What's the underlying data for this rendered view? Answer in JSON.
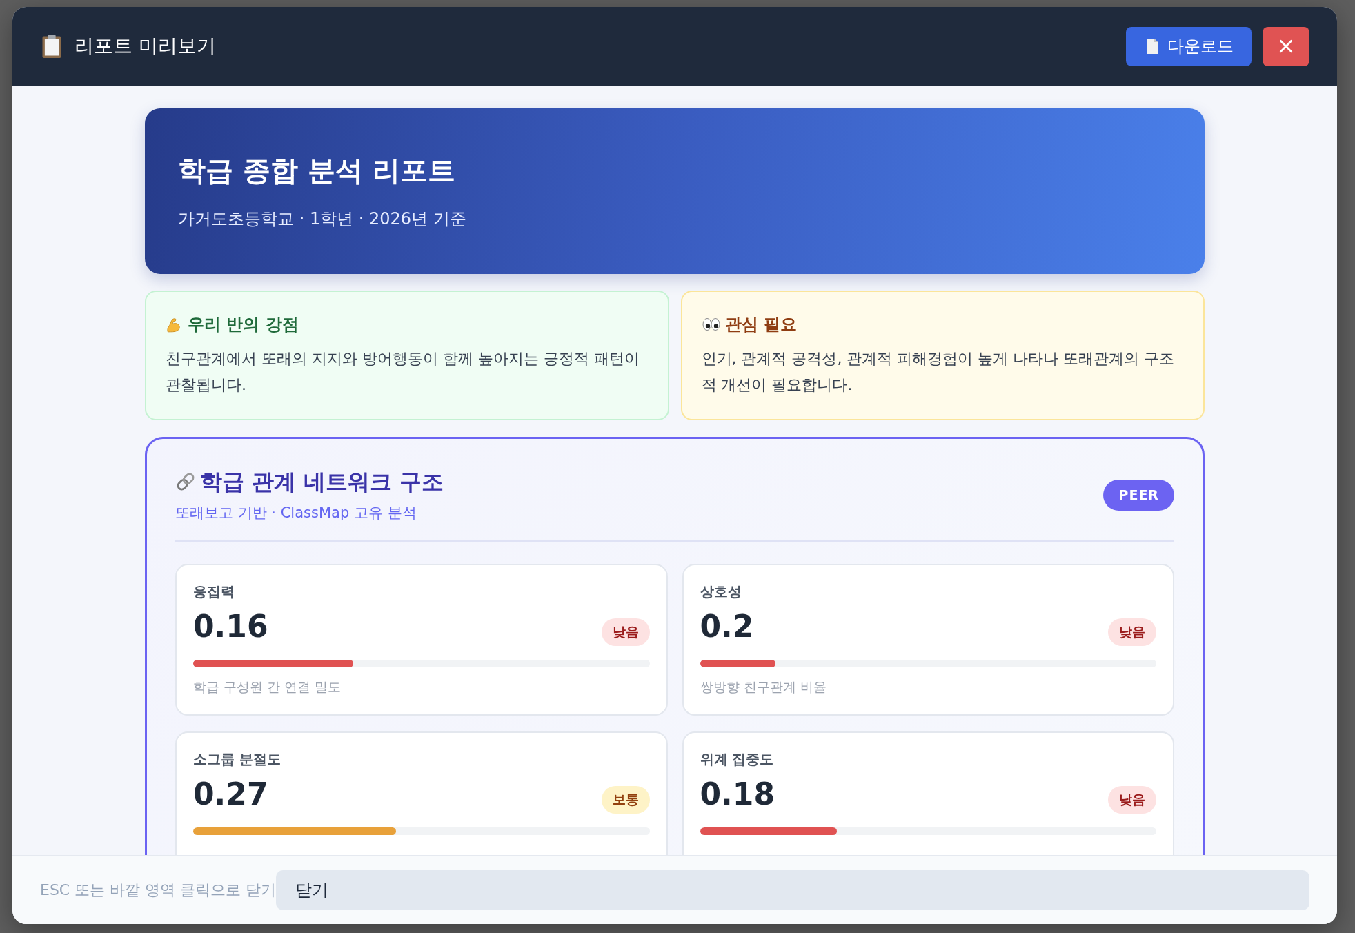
{
  "header": {
    "title": "리포트 미리보기",
    "download_button": "다운로드"
  },
  "report": {
    "title": "학급 종합 분석 리포트",
    "subtitle": "가거도초등학교 · 1학년 · 2026년 기준"
  },
  "highlights": [
    {
      "kind": "strength",
      "title": "우리 반의 강점",
      "text": "친구관계에서 또래의 지지와 방어행동이 함께 높아지는 긍정적 패턴이 관찰됩니다."
    },
    {
      "kind": "concern",
      "title": "관심 필요",
      "text": "인기, 관계적 공격성, 관계적 피해경험이 높게 나타나 또래관계의 구조적 개선이 필요합니다."
    }
  ],
  "network": {
    "title": "학급 관계 네트워크 구조",
    "subtitle": "또래보고 기반 · ClassMap 고유 분석",
    "badge": "PEER",
    "metrics": [
      {
        "label": "응집력",
        "value": "0.16",
        "status": "낮음",
        "kind": "low",
        "level": 0.35,
        "description": "학급 구성원 간 연결 밀도"
      },
      {
        "label": "상호성",
        "value": "0.2",
        "status": "낮음",
        "kind": "low",
        "level": 0.165,
        "description": "쌍방향 친구관계 비율"
      },
      {
        "label": "소그룹 분절도",
        "value": "0.27",
        "status": "보통",
        "kind": "medium",
        "level": 0.445
      },
      {
        "label": "위계 집중도",
        "value": "0.18",
        "status": "낮음",
        "kind": "low",
        "level": 0.3
      }
    ]
  },
  "footer": {
    "hint": "ESC 또는 바깥 영역 클릭으로 닫기",
    "close_button": "닫기"
  }
}
